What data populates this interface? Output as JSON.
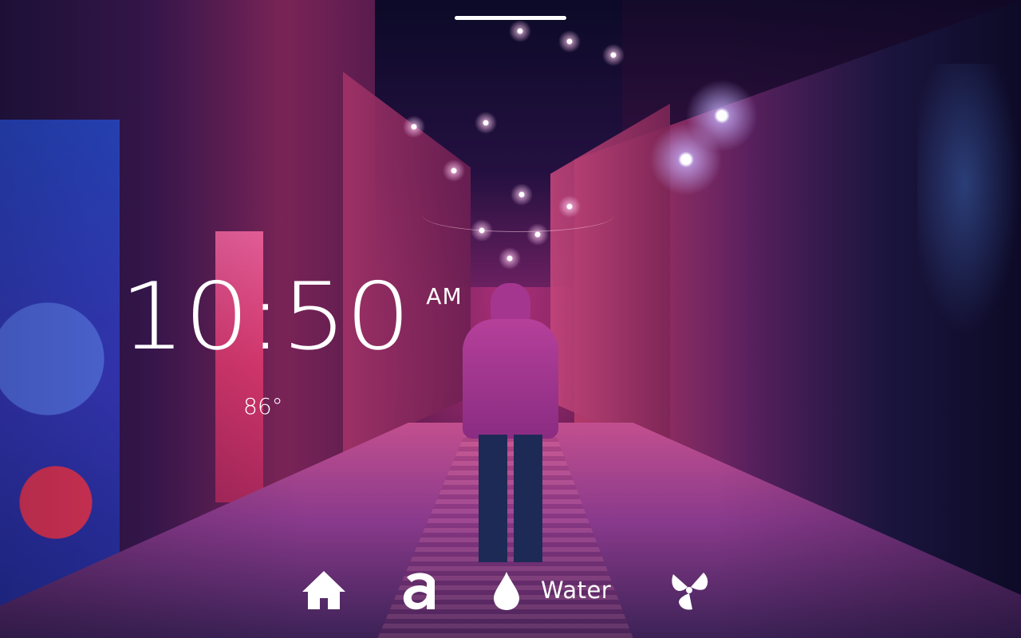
{
  "clock": {
    "time": "10:50",
    "ampm": "AM"
  },
  "weather": {
    "temperature": "86°"
  },
  "dock": {
    "items": [
      {
        "icon": "home-icon"
      },
      {
        "icon": "app-logo-icon"
      },
      {
        "icon": "water-drop-icon",
        "label": "Water"
      },
      {
        "icon": "fan-icon"
      }
    ]
  },
  "colors": {
    "foreground": "#ffffff",
    "accent_pink": "#c24f8e",
    "accent_purple": "#3a1244"
  }
}
